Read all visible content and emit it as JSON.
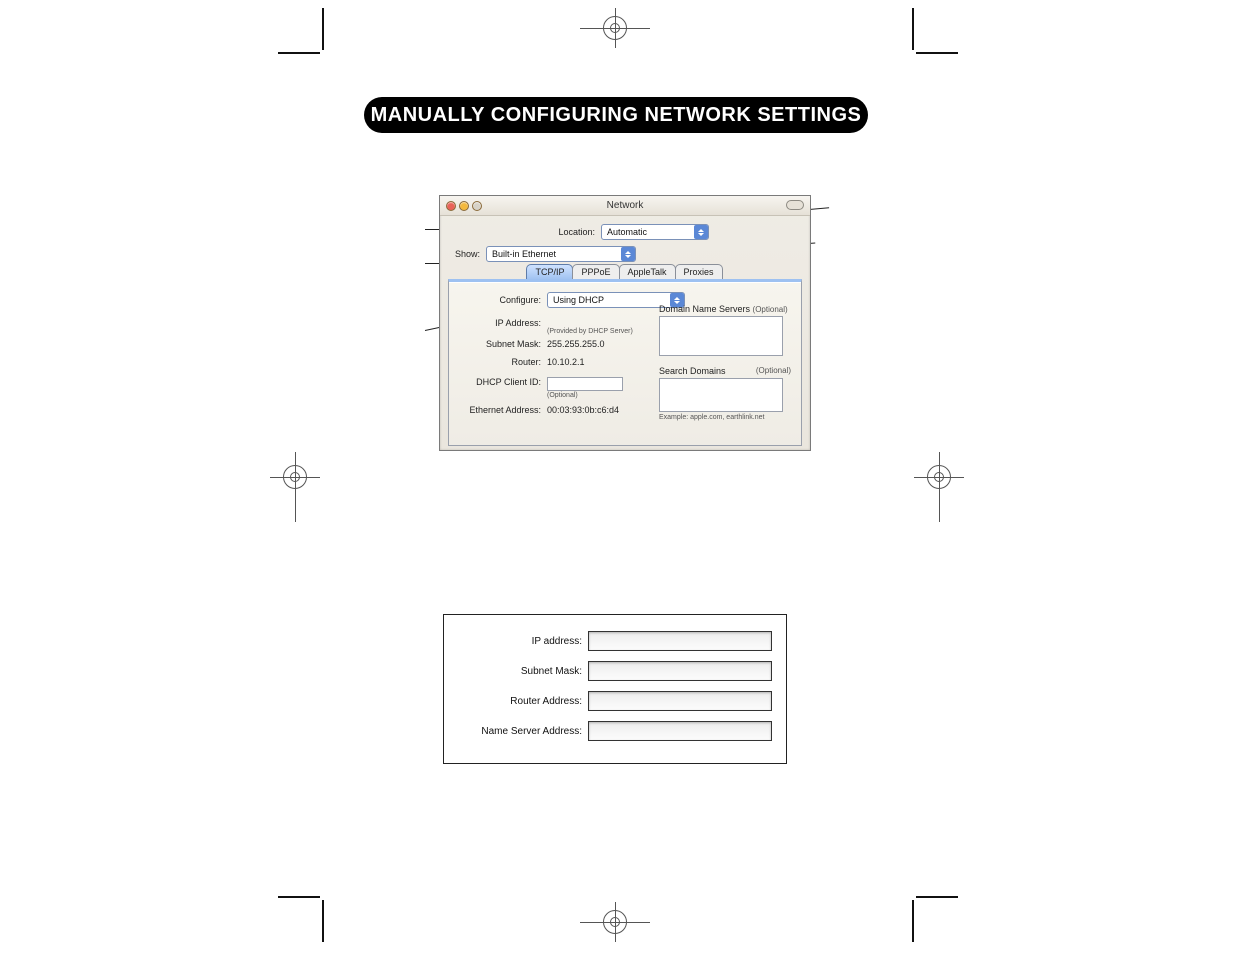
{
  "heading": "MANUALLY CONFIGURING NETWORK SETTINGS",
  "window": {
    "title": "Network",
    "location_label": "Location:",
    "location_value": "Automatic",
    "show_label": "Show:",
    "show_value": "Built-in Ethernet",
    "tabs": {
      "tcpip": "TCP/IP",
      "pppoe": "PPPoE",
      "appletalk": "AppleTalk",
      "proxies": "Proxies"
    },
    "configure_label": "Configure:",
    "configure_value": "Using DHCP",
    "ip_label": "IP Address:",
    "ip_note": "(Provided by DHCP Server)",
    "subnet_label": "Subnet Mask:",
    "subnet_value": "255.255.255.0",
    "router_label": "Router:",
    "router_value": "10.10.2.1",
    "dhcp_id_label": "DHCP Client ID:",
    "dhcp_id_note": "(Optional)",
    "eth_label": "Ethernet Address:",
    "eth_value": "00:03:93:0b:c6:d4",
    "dns_label": "Domain Name Servers",
    "dns_optional": "(Optional)",
    "search_label": "Search Domains",
    "search_optional": "(Optional)",
    "search_example": "Example: apple.com, earthlink.net"
  },
  "writein": {
    "ip": "IP address:",
    "subnet": "Subnet Mask:",
    "router": "Router Address:",
    "dns": "Name Server Address:"
  }
}
